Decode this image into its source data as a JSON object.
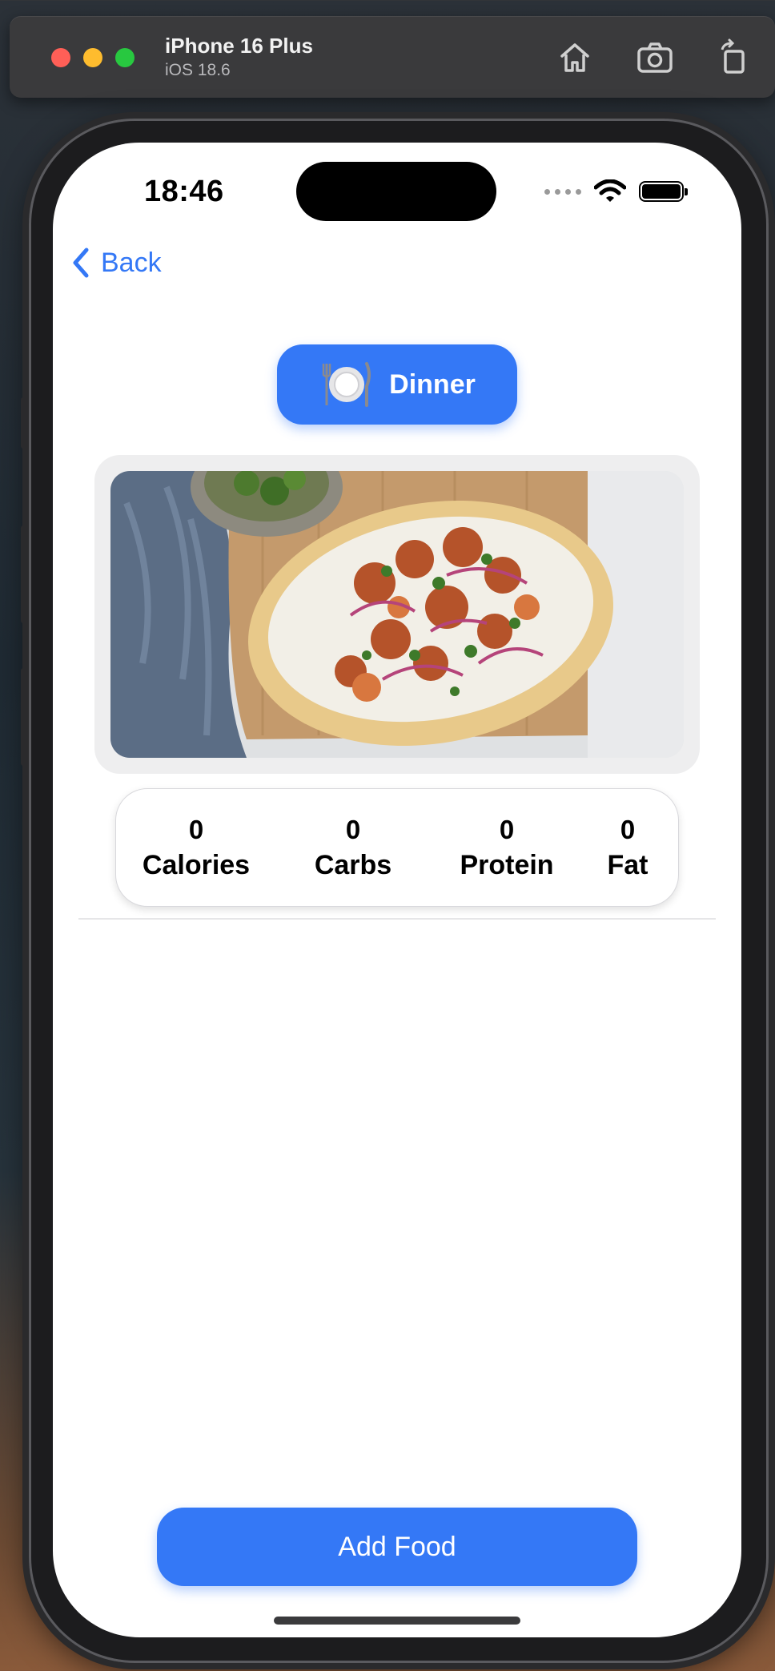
{
  "simulator": {
    "device_name": "iPhone 16 Plus",
    "os_version": "iOS 18.6",
    "icons": [
      "home-icon",
      "screenshot-icon",
      "rotate-icon"
    ]
  },
  "status_bar": {
    "time": "18:46",
    "icons": [
      "signal-dots-icon",
      "wifi-icon",
      "battery-icon"
    ]
  },
  "nav": {
    "back_label": "Back"
  },
  "meal": {
    "label": "Dinner",
    "icon": "plate-cutlery-icon",
    "image": "chicken-flatbread-photo"
  },
  "macros": [
    {
      "value": "0",
      "label": "Calories"
    },
    {
      "value": "0",
      "label": "Carbs"
    },
    {
      "value": "0",
      "label": "Protein"
    },
    {
      "value": "0",
      "label": "Fat"
    }
  ],
  "actions": {
    "add_food_label": "Add Food"
  },
  "colors": {
    "accent": "#3478f6"
  }
}
